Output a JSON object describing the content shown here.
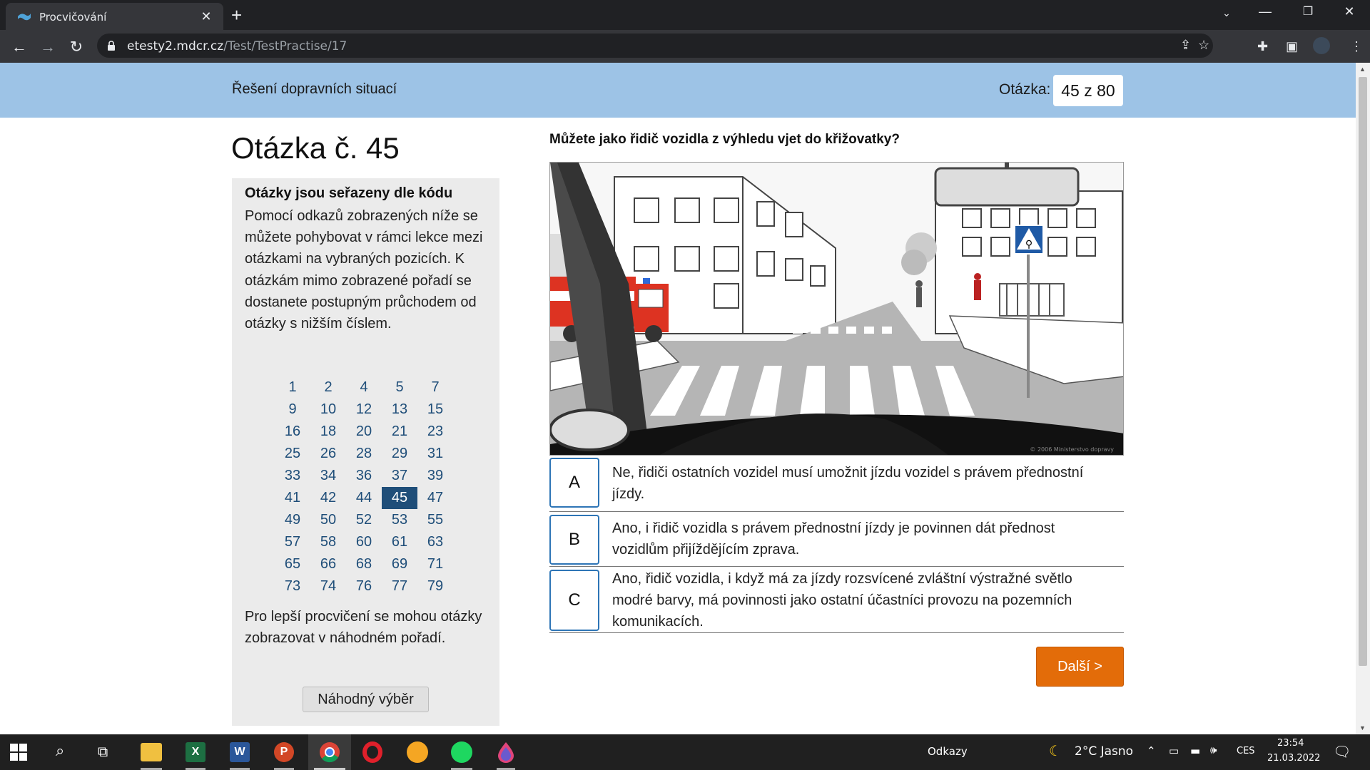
{
  "browser": {
    "tab_title": "Procvičování",
    "url_host": "etesty2.mdcr.cz",
    "url_path": "/Test/TestPractise/17"
  },
  "header": {
    "section_title": "Řešení dopravních situací",
    "counter_label": "Otázka:",
    "counter_value": "45 z 80"
  },
  "question": {
    "heading": "Otázka č. 45",
    "text": "Můžete jako řidič vozidla z výhledu vjet do křižovatky?",
    "image_copyright": "© 2006 Ministerstvo dopravy"
  },
  "sidebar": {
    "title": "Otázky jsou seřazeny dle kódu",
    "description": "Pomocí odkazů zobrazených níže se můžete pohybovat v rámci lekce mezi otázkami na vybraných pozicích. K otázkám mimo zobrazené pořadí se dostanete postupným průchodem od otázky s nižším číslem.",
    "numbers": [
      "1",
      "2",
      "4",
      "5",
      "7",
      "9",
      "10",
      "12",
      "13",
      "15",
      "16",
      "18",
      "20",
      "21",
      "23",
      "25",
      "26",
      "28",
      "29",
      "31",
      "33",
      "34",
      "36",
      "37",
      "39",
      "41",
      "42",
      "44",
      "45",
      "47",
      "49",
      "50",
      "52",
      "53",
      "55",
      "57",
      "58",
      "60",
      "61",
      "63",
      "65",
      "66",
      "68",
      "69",
      "71",
      "73",
      "74",
      "76",
      "77",
      "79"
    ],
    "active_number": "45",
    "random_text": "Pro lepší procvičení se mohou otázky zobrazovat v náhodném pořadí.",
    "random_button": "Náhodný výběr"
  },
  "answers": [
    {
      "letter": "A",
      "text": "Ne, řidiči ostatních vozidel musí umožnit jízdu vozidel s právem přednostní jízdy."
    },
    {
      "letter": "B",
      "text": "Ano, i řidič vozidla s právem přednostní jízdy je povinnen dát přednost vozidlům přijíždějícím zprava."
    },
    {
      "letter": "C",
      "text": "Ano, řidič vozidla, i když má za jízdy rozsvícené zvláštní výstražné světlo modré barvy, má povinnosti jako ostatní účastníci provozu na pozemních komunikacích."
    }
  ],
  "next_button": "Další >",
  "taskbar": {
    "search_label": "Odkazy",
    "weather": "2°C  Jasno",
    "lang": "CES",
    "time": "23:54",
    "date": "21.03.2022"
  },
  "colors": {
    "header_band": "#9dc3e6",
    "accent_blue": "#1f4e79",
    "answer_border": "#2e75b6",
    "next_button": "#e36c09"
  }
}
